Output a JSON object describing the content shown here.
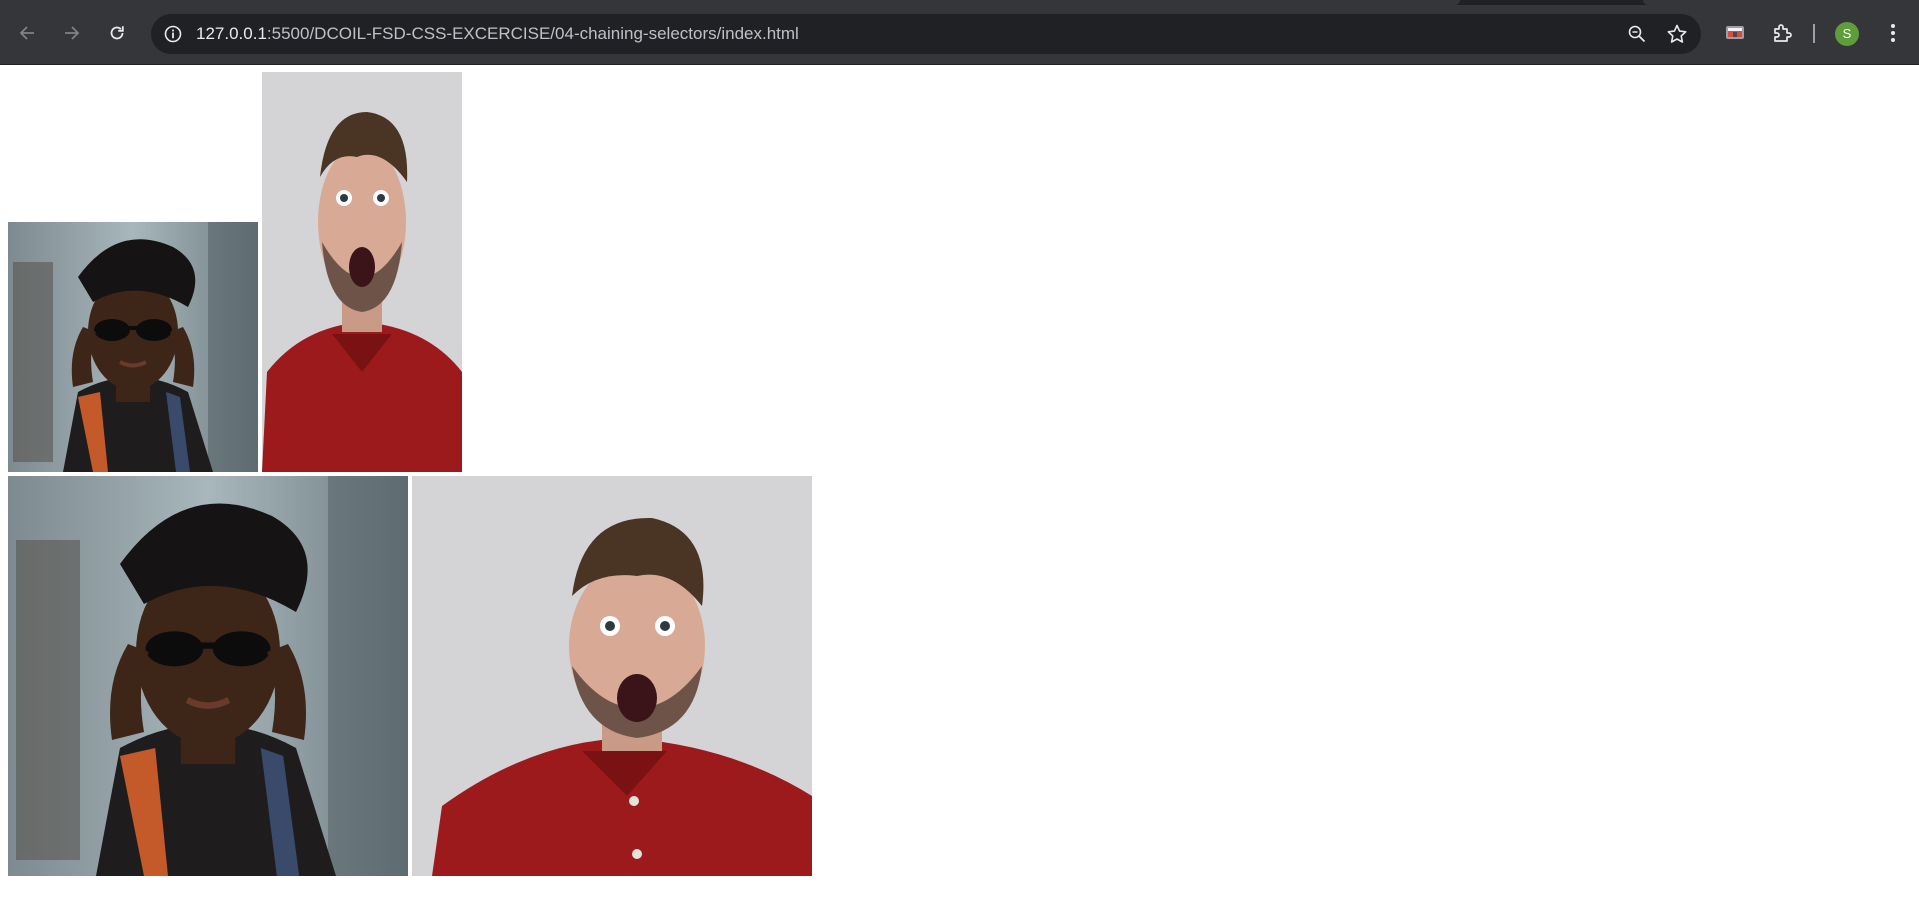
{
  "browser": {
    "url_host": "127.0.0.1",
    "url_path": ":5500/DCOIL-FSD-CSS-EXCERCISE/04-chaining-selectors/index.html",
    "icons": [
      "back-icon",
      "forward-icon",
      "reload-icon",
      "info-icon",
      "zoom-icon",
      "star-icon",
      "cast-icon",
      "extensions-icon",
      "menu-icon"
    ],
    "profile_initial": "S",
    "colors": {
      "toolbar": "#35363a",
      "omnibox": "#202124",
      "avatar": "#5f9c3a"
    }
  },
  "page": {
    "images": [
      {
        "subject": "woman in beret holding sunglasses"
      },
      {
        "subject": "surprised man in red polo shirt"
      },
      {
        "subject": "woman in beret holding sunglasses"
      },
      {
        "subject": "surprised man in red polo shirt"
      }
    ]
  }
}
